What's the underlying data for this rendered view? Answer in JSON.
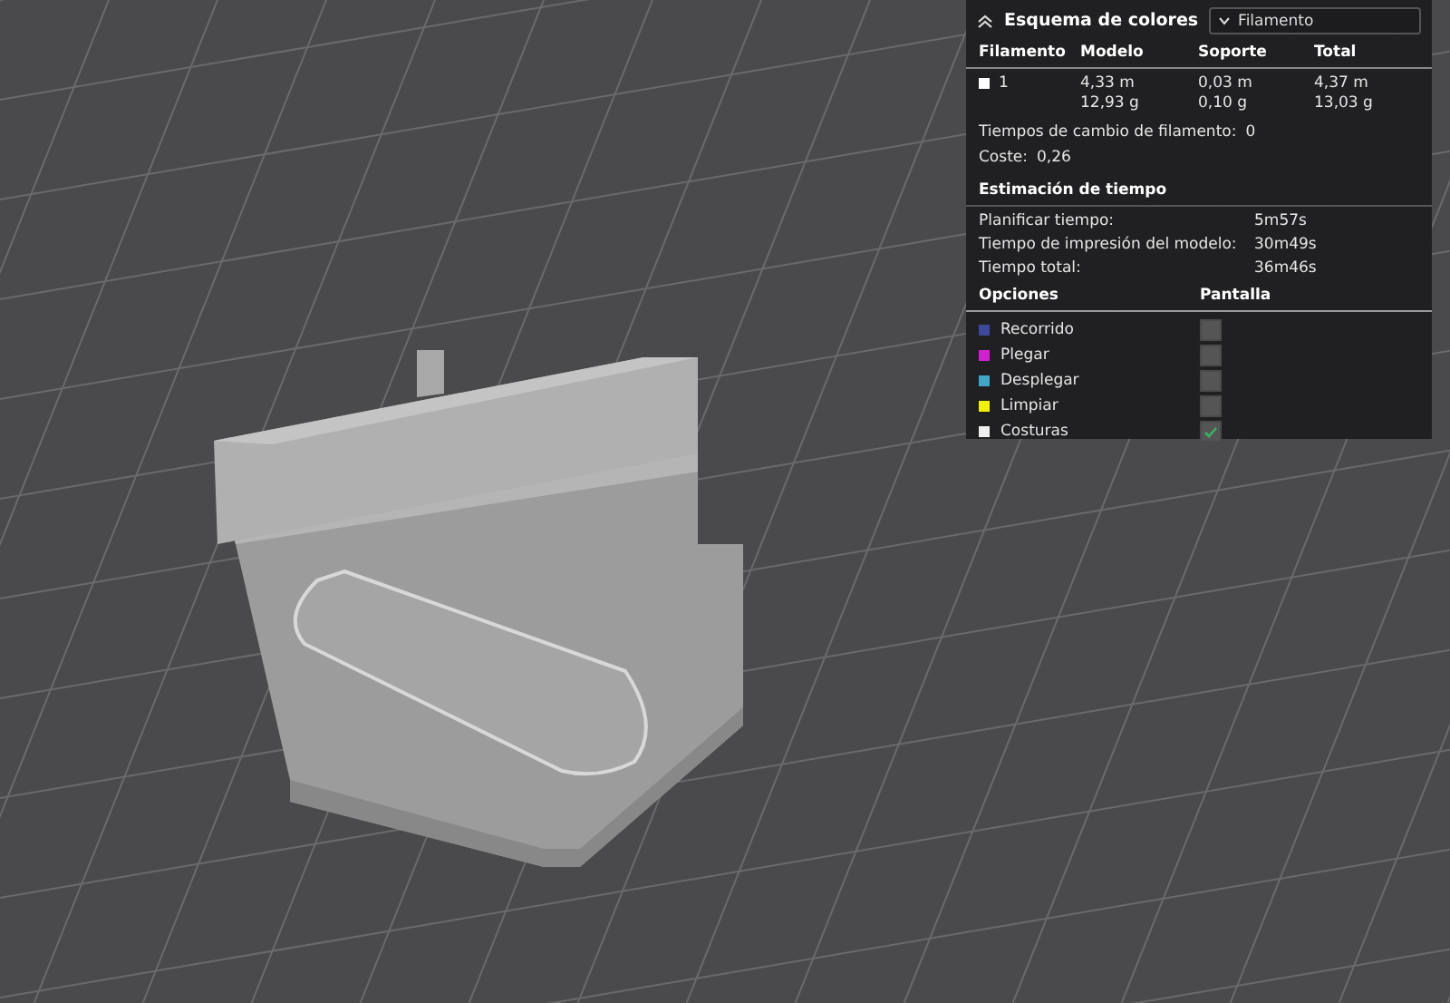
{
  "panel": {
    "title": "Esquema de colores",
    "scheme_dropdown": {
      "value": "Filamento"
    },
    "filament_table": {
      "columns": [
        "Filamento",
        "Modelo",
        "Soporte",
        "Total"
      ],
      "rows": [
        {
          "filament": "1",
          "color": "#ffffff",
          "model": [
            "4,33 m",
            "12,93 g"
          ],
          "support": [
            "0,03 m",
            "0,10 g"
          ],
          "total": [
            "4,37 m",
            "13,03 g"
          ]
        }
      ]
    },
    "stats": [
      {
        "label": "Tiempos de cambio de filamento:",
        "value": "0"
      },
      {
        "label": "Coste:",
        "value": "0,26"
      }
    ],
    "time_estimate": {
      "title": "Estimación de tiempo",
      "rows": [
        {
          "label": "Planificar tiempo:",
          "value": "5m57s"
        },
        {
          "label": "Tiempo de impresión del modelo:",
          "value": "30m49s"
        },
        {
          "label": "Tiempo total:",
          "value": "36m46s"
        }
      ]
    },
    "options": {
      "columns": [
        "Opciones",
        "Pantalla"
      ],
      "items": [
        {
          "label": "Recorrido",
          "color": "#3b4a9c",
          "checked": false
        },
        {
          "label": "Plegar",
          "color": "#d21fd2",
          "checked": false
        },
        {
          "label": "Desplegar",
          "color": "#3fa6c6",
          "checked": false
        },
        {
          "label": "Limpiar",
          "color": "#f2f200",
          "checked": false
        },
        {
          "label": "Costuras",
          "color": "#eeeeee",
          "checked": true
        }
      ]
    }
  }
}
